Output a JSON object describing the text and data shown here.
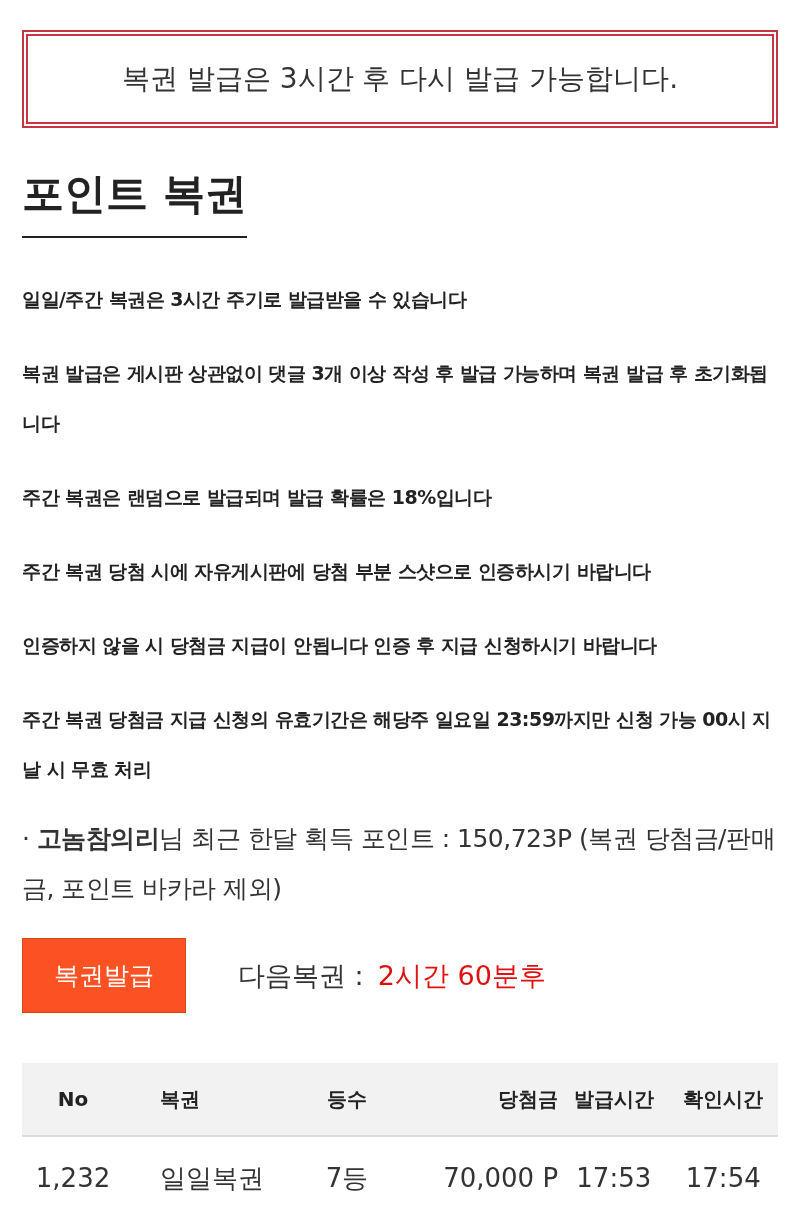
{
  "notice": "복권 발급은 3시간 후 다시 발급 가능합니다.",
  "title": "포인트 복권",
  "rules": [
    "일일/주간 복권은 3시간 주기로 발급받을 수 있습니다",
    "복권 발급은 게시판 상관없이 댓글 3개 이상 작성 후 발급 가능하며 복권 발급 후 초기화됩니다",
    "주간 복권은 랜덤으로 발급되며 발급 확률은 18%입니다",
    "주간 복권 당첨 시에 자유게시판에 당첨 부분 스샷으로 인증하시기 바랍니다",
    "인증하지 않을 시 당첨금 지급이 안됩니다 인증 후 지급 신청하시기 바랍니다",
    "주간 복권 당첨금 지급 신청의 유효기간은 해당주 일요일 23:59까지만 신청 가능 00시 지날 시 무효 처리"
  ],
  "summary": "· **고놈참의리**님 최근 한달 획득 포인트 : 150,723P (복권 당첨금/판매금, 포인트 바카라 제외)",
  "issue_button": "복권발급",
  "next_label": "다음복권 :",
  "next_value": "2시간 60분후",
  "table": {
    "columns": [
      "No",
      "복권",
      "등수",
      "당첨금",
      "발급시간",
      "확인시간"
    ],
    "rows": [
      [
        "1,232",
        "일일복권",
        "7등",
        "70,000 P",
        "17:53",
        "17:54"
      ]
    ]
  }
}
